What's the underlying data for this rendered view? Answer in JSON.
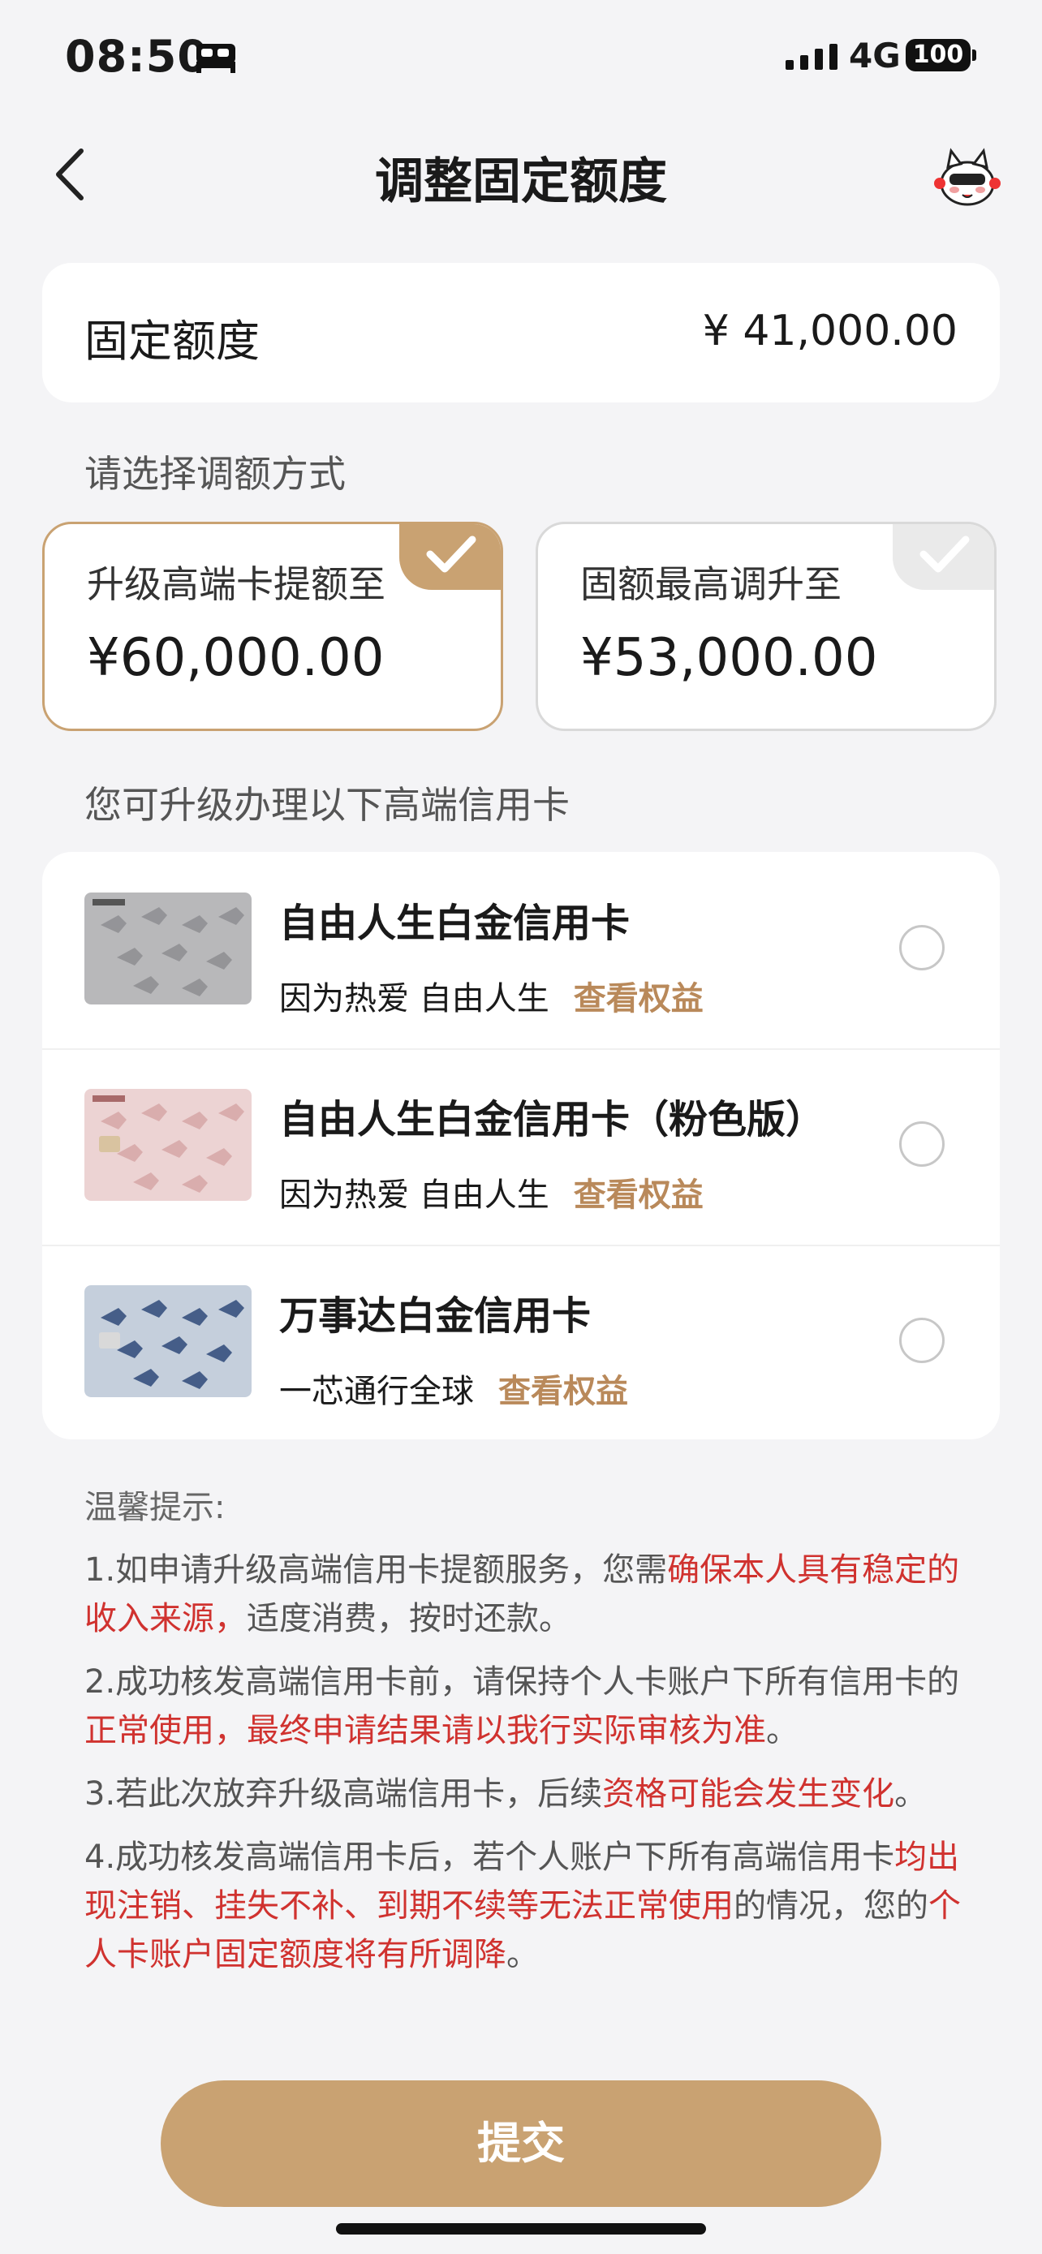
{
  "status_bar": {
    "time": "08:50",
    "network": "4G",
    "battery": "100"
  },
  "header": {
    "title": "调整固定额度"
  },
  "quota": {
    "label": "固定额度",
    "value": "¥ 41,000.00"
  },
  "method_section": {
    "label": "请选择调额方式",
    "options": [
      {
        "title": "升级高端卡提额至",
        "amount": "¥60,000.00",
        "selected": true
      },
      {
        "title": "固额最高调升至",
        "amount": "¥53,000.00",
        "selected": false
      }
    ]
  },
  "cards_section": {
    "label": "您可升级办理以下高端信用卡",
    "items": [
      {
        "name": "自由人生白金信用卡",
        "desc": "因为热爱 自由人生",
        "link": "查看权益",
        "thumb_color": "gray"
      },
      {
        "name": "自由人生白金信用卡（粉色版）",
        "desc": "因为热爱 自由人生",
        "link": "查看权益",
        "thumb_color": "pink"
      },
      {
        "name": "万事达白金信用卡",
        "desc": "一芯通行全球",
        "link": "查看权益",
        "thumb_color": "blue"
      }
    ]
  },
  "tips": {
    "title": "温馨提示:",
    "items": [
      {
        "p1": "1.如申请升级高端信用卡提额服务，您需",
        "r1": "确保本人具有稳定的收入来源，",
        "p2": "适度消费，按时还款。",
        "r2": "",
        "p3": ""
      },
      {
        "p1": "2.成功核发高端信用卡前，请保持个人卡账户下所有信用卡的",
        "r1": "正常使用，最终申请结果请以我行实际审核为准",
        "p2": "。",
        "r2": "",
        "p3": ""
      },
      {
        "p1": "3.若此次放弃升级高端信用卡，后续",
        "r1": "资格可能会发生变化",
        "p2": "。",
        "r2": "",
        "p3": ""
      },
      {
        "p1": "4.成功核发高端信用卡后，若个人账户下所有高端信用卡",
        "r1": "均出现注销、挂失不补、到期不续等无法正常使用",
        "p2": "的情况，您的",
        "r2": "个人卡账户固定额度将有所调降",
        "p3": "。"
      }
    ]
  },
  "submit": {
    "label": "提交"
  },
  "colors": {
    "accent": "#c9a272",
    "link": "#b9895a",
    "warning": "#d0322f"
  }
}
